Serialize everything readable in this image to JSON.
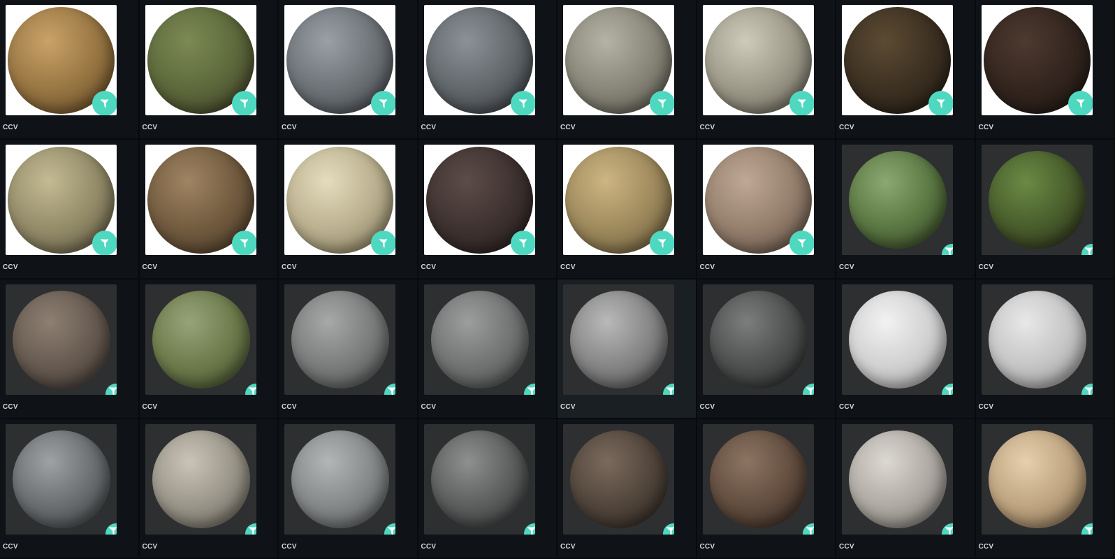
{
  "materials": [
    {
      "license": "CCV",
      "bg": "light",
      "colors": [
        "#c9a268",
        "#9a7844",
        "#5e4422"
      ],
      "icon": "material-badge-icon"
    },
    {
      "license": "CCV",
      "bg": "light",
      "colors": [
        "#7c8a55",
        "#5e6a3c",
        "#3d3a24"
      ],
      "icon": "material-badge-icon"
    },
    {
      "license": "CCV",
      "bg": "light",
      "colors": [
        "#9aa0a6",
        "#6f7479",
        "#3f4347"
      ],
      "icon": "material-badge-icon"
    },
    {
      "license": "CCV",
      "bg": "light",
      "colors": [
        "#8b9197",
        "#64696d",
        "#32363a"
      ],
      "icon": "material-badge-icon"
    },
    {
      "license": "CCV",
      "bg": "light",
      "colors": [
        "#b5b3a5",
        "#8a887a",
        "#55544b"
      ],
      "icon": "material-badge-icon"
    },
    {
      "license": "CCV",
      "bg": "light",
      "colors": [
        "#cfcbbb",
        "#9f9b8b",
        "#615d52"
      ],
      "icon": "material-badge-icon"
    },
    {
      "license": "CCV",
      "bg": "light",
      "colors": [
        "#5c4b33",
        "#3d3122",
        "#211a12"
      ],
      "icon": "material-badge-icon"
    },
    {
      "license": "CCV",
      "bg": "light",
      "colors": [
        "#4d3a30",
        "#34261f",
        "#1c1410"
      ],
      "icon": "material-badge-icon"
    },
    {
      "license": "CCV",
      "bg": "light",
      "colors": [
        "#c4bb94",
        "#958d6a",
        "#5c5640"
      ],
      "icon": "material-badge-icon"
    },
    {
      "license": "CCV",
      "bg": "light",
      "colors": [
        "#a08563",
        "#735c40",
        "#463624"
      ],
      "icon": "material-badge-icon"
    },
    {
      "license": "CCV",
      "bg": "light",
      "colors": [
        "#e4dcbd",
        "#bcb291",
        "#7d7457"
      ],
      "icon": "material-badge-icon"
    },
    {
      "license": "CCV",
      "bg": "light",
      "colors": [
        "#5d4c48",
        "#3f3331",
        "#221b1a"
      ],
      "icon": "material-badge-icon"
    },
    {
      "license": "CCV",
      "bg": "light",
      "colors": [
        "#cdb583",
        "#a08b5e",
        "#645638"
      ],
      "icon": "material-badge-icon"
    },
    {
      "license": "CCV",
      "bg": "light",
      "colors": [
        "#bfa896",
        "#96806e",
        "#5c4c40"
      ],
      "icon": "material-badge-icon"
    },
    {
      "license": "CCV",
      "bg": "dark",
      "colors": [
        "#8ca872",
        "#5d7a45",
        "#30401f"
      ],
      "icon": "material-badge-icon"
    },
    {
      "license": "CCV",
      "bg": "dark",
      "colors": [
        "#6b8a45",
        "#4a5f2d",
        "#2a2a18"
      ],
      "icon": "material-badge-icon"
    },
    {
      "license": "CCV",
      "bg": "dark",
      "colors": [
        "#8e7f72",
        "#685c52",
        "#3d3530"
      ],
      "icon": "material-badge-icon"
    },
    {
      "license": "CCV",
      "bg": "dark",
      "colors": [
        "#98a27a",
        "#6e7d4d",
        "#3f4a2a"
      ],
      "icon": "material-badge-icon"
    },
    {
      "license": "CCV",
      "bg": "dark",
      "colors": [
        "#a7a9a8",
        "#7c7e7d",
        "#4a4c4b"
      ],
      "icon": "material-badge-icon"
    },
    {
      "license": "CCV",
      "bg": "dark",
      "colors": [
        "#9c9e9d",
        "#737574",
        "#434544"
      ],
      "icon": "material-badge-icon"
    },
    {
      "license": "CCV",
      "bg": "dark",
      "colors": [
        "#b8b9b8",
        "#868786",
        "#4a4b4a"
      ],
      "icon": "material-badge-icon"
    },
    {
      "license": "CCV",
      "bg": "dark",
      "colors": [
        "#7b7e7c",
        "#4f5250",
        "#242625"
      ],
      "icon": "material-badge-icon"
    },
    {
      "license": "CCV",
      "bg": "dark",
      "colors": [
        "#f2f2f2",
        "#d2d2d2",
        "#9a9a9a"
      ],
      "icon": "material-badge-icon"
    },
    {
      "license": "CCV",
      "bg": "dark",
      "colors": [
        "#e8e8e8",
        "#c6c6c6",
        "#8e8e8e"
      ],
      "icon": "material-badge-icon"
    },
    {
      "license": "CCV",
      "bg": "dark",
      "colors": [
        "#9ea2a4",
        "#6c7073",
        "#393c3e"
      ],
      "icon": "material-badge-icon"
    },
    {
      "license": "CCV",
      "bg": "dark",
      "colors": [
        "#c9c4b7",
        "#9c978b",
        "#625e55"
      ],
      "icon": "material-badge-icon"
    },
    {
      "license": "CCV",
      "bg": "dark",
      "colors": [
        "#b3b6b7",
        "#878a8b",
        "#505354"
      ],
      "icon": "material-badge-icon"
    },
    {
      "license": "CCV",
      "bg": "dark",
      "colors": [
        "#8d908f",
        "#5d605f",
        "#2b2d2c"
      ],
      "icon": "material-badge-icon"
    },
    {
      "license": "CCV",
      "bg": "dark",
      "colors": [
        "#7a6a5c",
        "#53473d",
        "#2a231d"
      ],
      "icon": "material-badge-icon"
    },
    {
      "license": "CCV",
      "bg": "dark",
      "colors": [
        "#8c7462",
        "#644f40",
        "#33271f"
      ],
      "icon": "material-badge-icon"
    },
    {
      "license": "CCV",
      "bg": "dark",
      "colors": [
        "#dcd8d2",
        "#b0aca5",
        "#726e68"
      ],
      "icon": "material-badge-icon"
    },
    {
      "license": "CCV",
      "bg": "dark",
      "colors": [
        "#e6cfae",
        "#c0a682",
        "#806a4d"
      ],
      "icon": "material-badge-icon"
    }
  ],
  "hovered_index": 20,
  "badge_color": "#4fd8c0"
}
